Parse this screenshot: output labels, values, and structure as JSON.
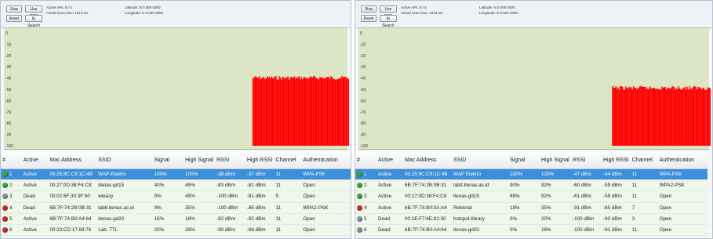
{
  "colors": {
    "green": "#3fa53a",
    "red": "#c9302c",
    "grey": "#8a8f96",
    "selection": "#3d8fdb",
    "chart_bg": "#dce6c6",
    "bars": "#ff0000"
  },
  "panels": [
    {
      "toolbar": {
        "stop_label": "Stop",
        "use_gps_label": "Use GPS",
        "reset_label": "Reset",
        "ip_search_label": "Ip Search",
        "active_aps": "Active APs: 6 / 6",
        "actual_scan_time": "Actual Scan time: 1013 ms",
        "latitude": "Latitude: N 0.000 0000",
        "longitude": "Longitude: E 0.000 0000"
      },
      "chart_data": {
        "type": "area",
        "yticks": [
          "0",
          "-10",
          "-20",
          "-30",
          "-40",
          "-50",
          "-60",
          "-70",
          "-80",
          "-90",
          "-100"
        ],
        "ylim": [
          -100,
          0
        ],
        "series": [
          {
            "start_fraction": 0.72,
            "end_fraction": 1.0,
            "level_dbm": -38
          }
        ]
      },
      "table": {
        "headers": [
          "#",
          "Active",
          "Mac Address",
          "SSID",
          "Signal",
          "High Signal",
          "RSSI",
          "High RSSI",
          "Channel",
          "Authentication"
        ],
        "rows": [
          {
            "num": "1",
            "status": "green",
            "active": "Active",
            "mac": "00:25:9C:C9:1C:4B",
            "ssid": "WAP Elektro",
            "signal": "100%",
            "high_signal": "100%",
            "rssi": "-38 dBm",
            "high_rssi": "-37 dBm",
            "channel": "11",
            "auth": "WPA-PSK",
            "selected": true
          },
          {
            "num": "2",
            "status": "green",
            "active": "Active",
            "mac": "00:27:0D:38:F4:C8",
            "ssid": "itenas-gd15",
            "signal": "40%",
            "high_signal": "45%",
            "rssi": "-83 dBm",
            "high_rssi": "-81 dBm",
            "channel": "11",
            "auth": "Open",
            "selected": false
          },
          {
            "num": "3",
            "status": "grey",
            "active": "Dead",
            "mac": "00:02:6F:30:3F:90",
            "ssid": "wleazy",
            "signal": "0%",
            "high_signal": "45%",
            "rssi": "-100 dBm",
            "high_rssi": "-81 dBm",
            "channel": "9",
            "auth": "Open",
            "selected": false
          },
          {
            "num": "4",
            "status": "red",
            "active": "Dead",
            "mac": "6B:7F:74:2B:0B:31",
            "ssid": "labtt.itenas.ac.id",
            "signal": "0%",
            "high_signal": "35%",
            "rssi": "-100 dBm",
            "high_rssi": "-85 dBm",
            "channel": "11",
            "auth": "WPA2-PSK",
            "selected": false
          },
          {
            "num": "5",
            "status": "red",
            "active": "Active",
            "mac": "6B:7F:74:B0:A4:64",
            "ssid": "itenas-gd20",
            "signal": "16%",
            "high_signal": "16%",
            "rssi": "-92 dBm",
            "high_rssi": "-92 dBm",
            "channel": "11",
            "auth": "Open",
            "selected": false
          },
          {
            "num": "6",
            "status": "red",
            "active": "Active",
            "mac": "00:23:CD:17:89:76",
            "ssid": "Lab. TTL",
            "signal": "20%",
            "high_signal": "26%",
            "rssi": "-90 dBm",
            "high_rssi": "-88 dBm",
            "channel": "11",
            "auth": "Open",
            "selected": false
          }
        ]
      }
    },
    {
      "toolbar": {
        "stop_label": "Stop",
        "use_gps_label": "Use GPS",
        "reset_label": "Reset",
        "ip_search_label": "Ip Search",
        "active_aps": "Active APs: 6 / 6",
        "actual_scan_time": "Actual Scan time: 1013 ms",
        "latitude": "Latitude: N 0.000 0000",
        "longitude": "Longitude: E 0.000 0000"
      },
      "chart_data": {
        "type": "area",
        "yticks": [
          "0",
          "-10",
          "-20",
          "-30",
          "-40",
          "-50",
          "-60",
          "-70",
          "-80",
          "-90",
          "-100"
        ],
        "ylim": [
          -100,
          0
        ],
        "series": [
          {
            "start_fraction": 0.72,
            "end_fraction": 1.0,
            "level_dbm": -47
          }
        ]
      },
      "table": {
        "headers": [
          "#",
          "Active",
          "Mac Address",
          "SSID",
          "Signal",
          "High Signal",
          "RSSI",
          "High RSSI",
          "Channel",
          "Authentication"
        ],
        "rows": [
          {
            "num": "1",
            "status": "green",
            "active": "Active",
            "mac": "00:25:9C:C9:1C:4B",
            "ssid": "WAP Elektro",
            "signal": "100%",
            "high_signal": "100%",
            "rssi": "-47 dBm",
            "high_rssi": "-44 dBm",
            "channel": "11",
            "auth": "WPA-PSK",
            "selected": true
          },
          {
            "num": "2",
            "status": "green",
            "active": "Active",
            "mac": "6B:7F:74:2B:0B:31",
            "ssid": "labtt.itenas.ac.id",
            "signal": "90%",
            "high_signal": "92%",
            "rssi": "-60 dBm",
            "high_rssi": "-59 dBm",
            "channel": "11",
            "auth": "WPA2-PSK",
            "selected": false
          },
          {
            "num": "3",
            "status": "green",
            "active": "Active",
            "mac": "00:27:0D:38:F4:C8",
            "ssid": "itenas-gd15",
            "signal": "88%",
            "high_signal": "92%",
            "rssi": "-61 dBm",
            "high_rssi": "-59 dBm",
            "channel": "11",
            "auth": "Open",
            "selected": false
          },
          {
            "num": "4",
            "status": "red",
            "active": "Active",
            "mac": "6B:7F:74:B0:0A:A4",
            "ssid": "Rektorat",
            "signal": "18%",
            "high_signal": "35%",
            "rssi": "-91 dBm",
            "high_rssi": "-85 dBm",
            "channel": "7",
            "auth": "Open",
            "selected": false
          },
          {
            "num": "5",
            "status": "grey",
            "active": "Dead",
            "mac": "00:1E:F7:6E:81:30",
            "ssid": "hotspot-library",
            "signal": "0%",
            "high_signal": "20%",
            "rssi": "-100 dBm",
            "high_rssi": "-90 dBm",
            "channel": "3",
            "auth": "Open",
            "selected": false
          },
          {
            "num": "6",
            "status": "grey",
            "active": "Dead",
            "mac": "6B:7F:74:B0:A4:64",
            "ssid": "itenas-gd20",
            "signal": "0%",
            "high_signal": "18%",
            "rssi": "-100 dBm",
            "high_rssi": "-91 dBm",
            "channel": "11",
            "auth": "Open",
            "selected": false
          }
        ]
      }
    }
  ]
}
